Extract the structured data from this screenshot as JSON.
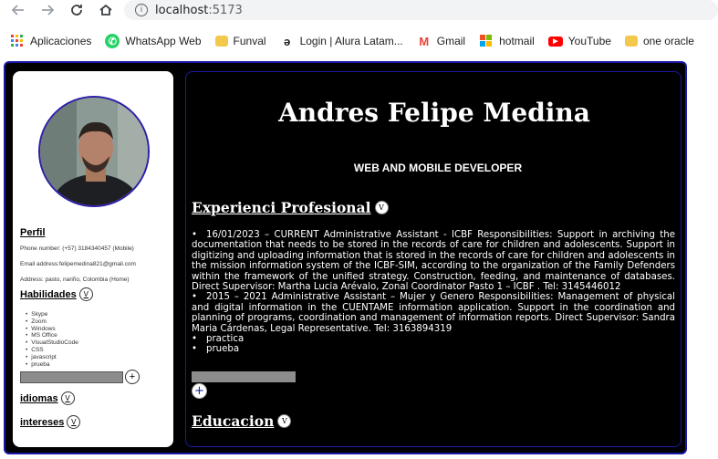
{
  "browser": {
    "url_host": "localhost",
    "url_port": ":5173",
    "bookmarks": [
      {
        "label": "Aplicaciones",
        "icon": "apps-grid-icon"
      },
      {
        "label": "WhatsApp Web",
        "icon": "whatsapp-icon"
      },
      {
        "label": "Funval",
        "icon": "folder-icon"
      },
      {
        "label": "Login | Alura Latam...",
        "icon": "alura-icon"
      },
      {
        "label": "Gmail",
        "icon": "gmail-icon"
      },
      {
        "label": "hotmail",
        "icon": "microsoft-icon"
      },
      {
        "label": "YouTube",
        "icon": "youtube-icon"
      },
      {
        "label": "one oracle",
        "icon": "folder-icon"
      }
    ]
  },
  "sidebar": {
    "perfil_title": "Perfil",
    "phone": "Phone number: (+57) 3184340457 (Mobile)",
    "email": "Email address:felipemedina821@gmail.com",
    "address": "Address: pasto, nariño, Colombia (Home)",
    "habilidades_title": "Habilidades",
    "skills": [
      "Skype",
      "Zoom",
      "Windows",
      "MS Office",
      "VisualStudioCode",
      "CSS",
      "javascript",
      "prueba"
    ],
    "idiomas_title": "idiomas",
    "intereses_title": "intereses",
    "toggle_symbol": "V",
    "add_symbol": "+"
  },
  "main": {
    "name": "Andres Felipe Medina",
    "role": "WEB AND MOBILE DEVELOPER",
    "experience_title": "Experienci Profesional",
    "experience": [
      "16/01/2023 – CURRENT Administrative Assistant - ICBF Responsibilities: Support in archiving the documentation that needs to be stored in the records of care for children and adolescents. Support in digitizing and uploading information that is stored in the records of care for children and adolescents in the mission information system of the ICBF-SIM, according to the organization of the Family Defenders within the framework of the unified strategy. Construction, feeding, and maintenance of databases. Direct Supervisor: Martha Lucia Arévalo, Zonal Coordinator Pasto 1 – ICBF . Tel: 3145446012",
      "2015 – 2021 Administrative Assistant – Mujer y Genero Responsibilities: Management of physical and digital information in the CUENTAME information application. Support in the coordination and planning of programs, coordination and management of information reports. Direct Supervisor: Sandra Maria Cárdenas, Legal Representative. Tel: 3163894319",
      "practica",
      "prueba"
    ],
    "education_title": "Educacion",
    "toggle_symbol": "V",
    "add_symbol": "+"
  }
}
